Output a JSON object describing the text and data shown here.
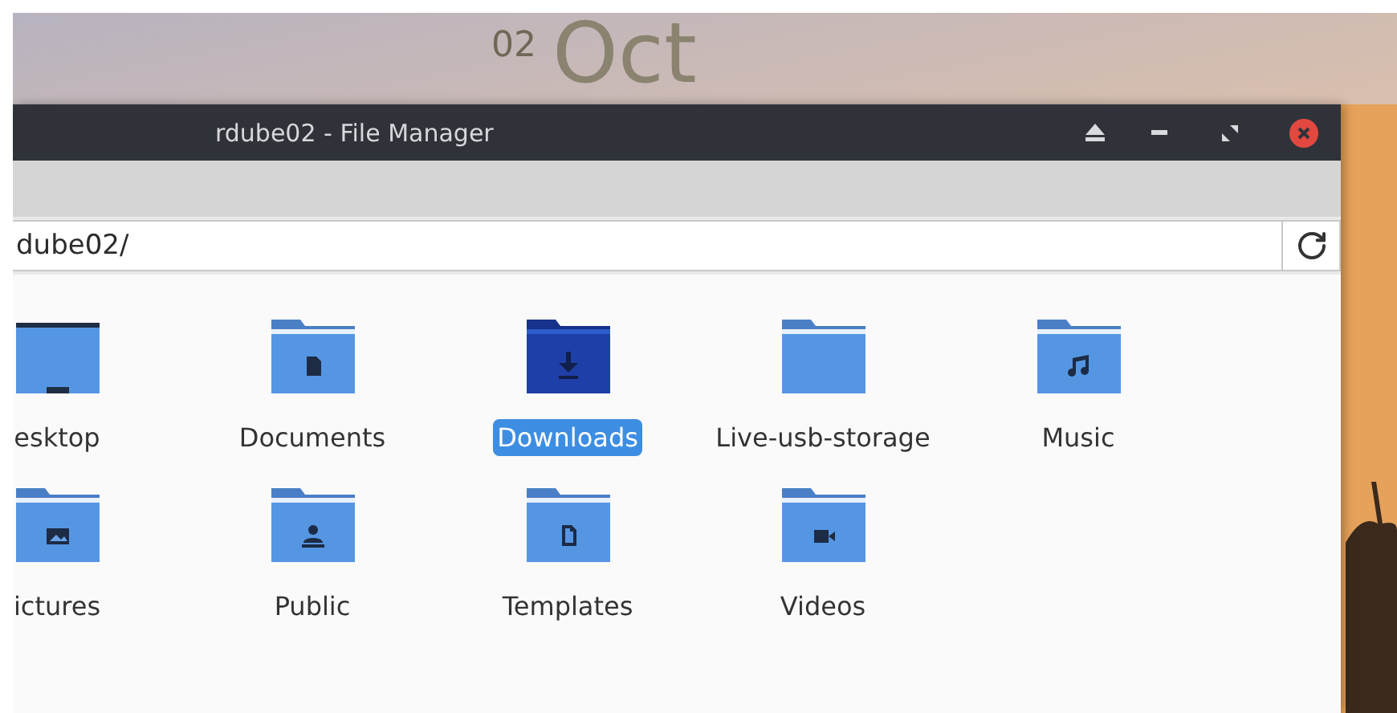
{
  "desktop_clock": {
    "day": "02",
    "month": "Oct"
  },
  "window": {
    "title": "rdube02 - File Manager"
  },
  "location": {
    "value": "dube02/"
  },
  "items": [
    {
      "name": "esktop",
      "kind": "desktop",
      "selected": false
    },
    {
      "name": "Documents",
      "kind": "documents",
      "selected": false
    },
    {
      "name": "Downloads",
      "kind": "downloads",
      "selected": true
    },
    {
      "name": "Live-usb-storage",
      "kind": "folder",
      "selected": false
    },
    {
      "name": "Music",
      "kind": "music",
      "selected": false
    },
    {
      "name": "ictures",
      "kind": "pictures",
      "selected": false
    },
    {
      "name": "Public",
      "kind": "public",
      "selected": false
    },
    {
      "name": "Templates",
      "kind": "templates",
      "selected": false
    },
    {
      "name": "Videos",
      "kind": "videos",
      "selected": false
    }
  ]
}
